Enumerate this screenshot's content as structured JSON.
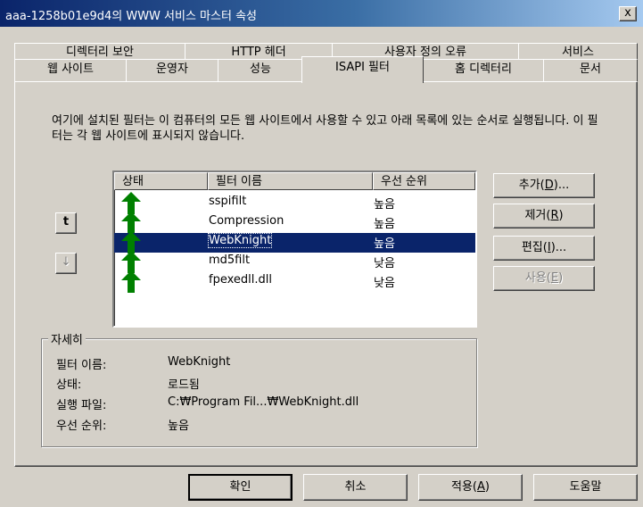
{
  "window": {
    "title": "aaa-1258b01e9d4의 WWW 서비스 마스터 속성",
    "close_label": "x"
  },
  "tabs_row1": [
    {
      "label": "디렉터리 보안"
    },
    {
      "label": "HTTP 헤더"
    },
    {
      "label": "사용자 정의 오류"
    },
    {
      "label": "서비스"
    }
  ],
  "tabs_row2": [
    {
      "label": "웹 사이트"
    },
    {
      "label": "운영자"
    },
    {
      "label": "성능"
    },
    {
      "label": "ISAPI 필터",
      "active": true
    },
    {
      "label": "홈 디렉터리"
    },
    {
      "label": "문서"
    }
  ],
  "description": "여기에 설치된 필터는 이 컴퓨터의 모든 웹 사이트에서 사용할 수 있고 아래 목록에 있는 순서로 실행됩니다. 이 필터는 각 웹 사이트에 표시되지 않습니다.",
  "list": {
    "columns": [
      "상태",
      "필터 이름",
      "우선 순위"
    ],
    "rows": [
      {
        "status_icon": "green-up-arrow-icon",
        "name": "sspifilt",
        "priority": "높음"
      },
      {
        "status_icon": "green-up-arrow-icon",
        "name": "Compression",
        "priority": "높음"
      },
      {
        "status_icon": "green-up-arrow-icon",
        "name": "WebKnight",
        "priority": "높음",
        "selected": true
      },
      {
        "status_icon": "green-up-arrow-icon",
        "name": "md5filt",
        "priority": "낮음"
      },
      {
        "status_icon": "green-up-arrow-icon",
        "name": "fpexedll.dll",
        "priority": "낮음"
      }
    ]
  },
  "order_buttons": {
    "up_label": "t",
    "down_label": "↓"
  },
  "side_buttons": {
    "add": {
      "text": "추가(",
      "key": "D",
      "suffix": ")..."
    },
    "remove": {
      "text": "제거(",
      "key": "R",
      "suffix": ")"
    },
    "edit": {
      "text": "편집(",
      "key": "I",
      "suffix": ")..."
    },
    "enable": {
      "text": "사용(",
      "key": "E",
      "suffix": ")"
    }
  },
  "details": {
    "legend": "자세히",
    "name_label": "필터 이름:",
    "name_value": "WebKnight",
    "status_label": "상태:",
    "status_value": "로드됨",
    "exe_label": "실행 파일:",
    "exe_value": "C:₩Program Fil...₩WebKnight.dll",
    "priority_label": "우선 순위:",
    "priority_value": "높음"
  },
  "footer": {
    "ok": "확인",
    "cancel": "취소",
    "apply": {
      "text": "적용(",
      "key": "A",
      "suffix": ")"
    },
    "help": "도움말"
  },
  "colors": {
    "face": "#d4d0c8",
    "selection": "#0a246a",
    "arrow_green": "#008000",
    "title_start": "#0a246a",
    "title_end": "#a6caf0"
  }
}
